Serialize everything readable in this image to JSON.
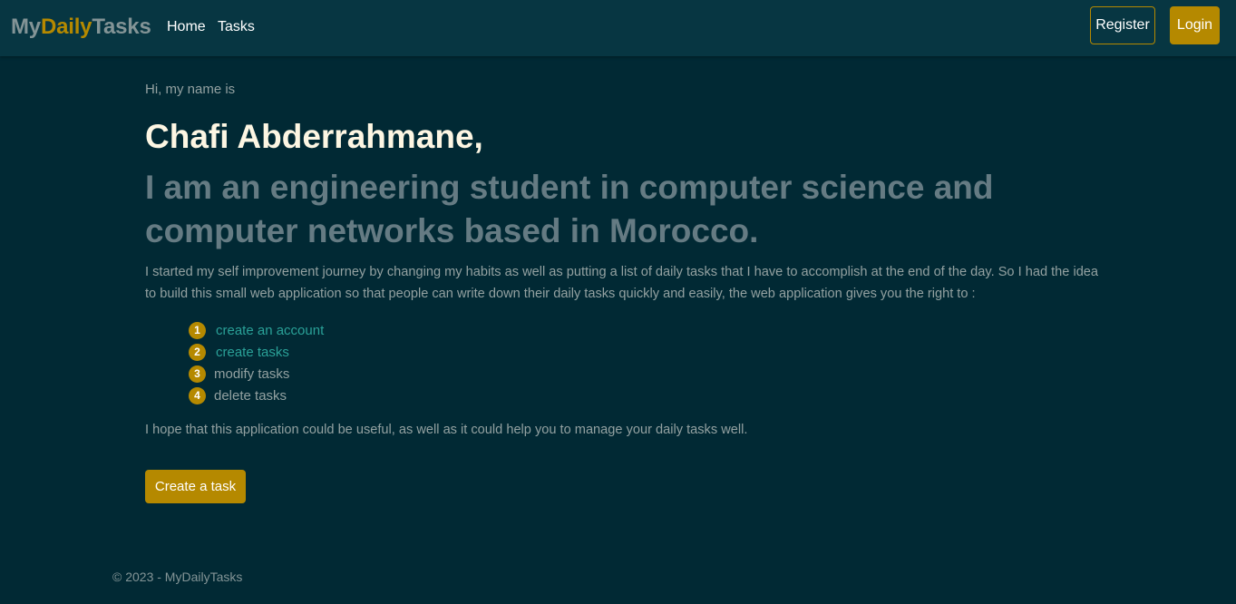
{
  "navbar": {
    "brand": {
      "part1": "My",
      "part2": "Daily",
      "part3": "Tasks"
    },
    "links": [
      "Home",
      "Tasks"
    ],
    "register_label": "Register",
    "login_label": "Login"
  },
  "hero": {
    "intro": "Hi, my name is",
    "name": "Chafi Abderrahmane,",
    "tagline": "I am an engineering student in computer science and computer networks based in Morocco.",
    "description": "I started my self improvement journey by changing my habits as well as putting a list of daily tasks that I have to accomplish at the end of the day. So I had the idea to build this small web application so that people can write down their daily tasks quickly and easily, the web application gives you the right to :",
    "features": [
      {
        "number": "1",
        "label": "create an account"
      },
      {
        "number": "2",
        "label": "create tasks"
      },
      {
        "number": "3",
        "label": "modify tasks"
      },
      {
        "number": "4",
        "label": "delete tasks"
      }
    ],
    "closing": "I hope that this application could be useful, as well as it could help you to manage your daily tasks well.",
    "cta_label": "Create a task"
  },
  "footer": {
    "text": "© 2023 - MyDailyTasks"
  },
  "colors": {
    "background": "#012934",
    "navbar": "#073642",
    "accent": "#b58900",
    "link": "#2aa198",
    "name": "#fdf6e3",
    "tagline": "#657b83"
  }
}
